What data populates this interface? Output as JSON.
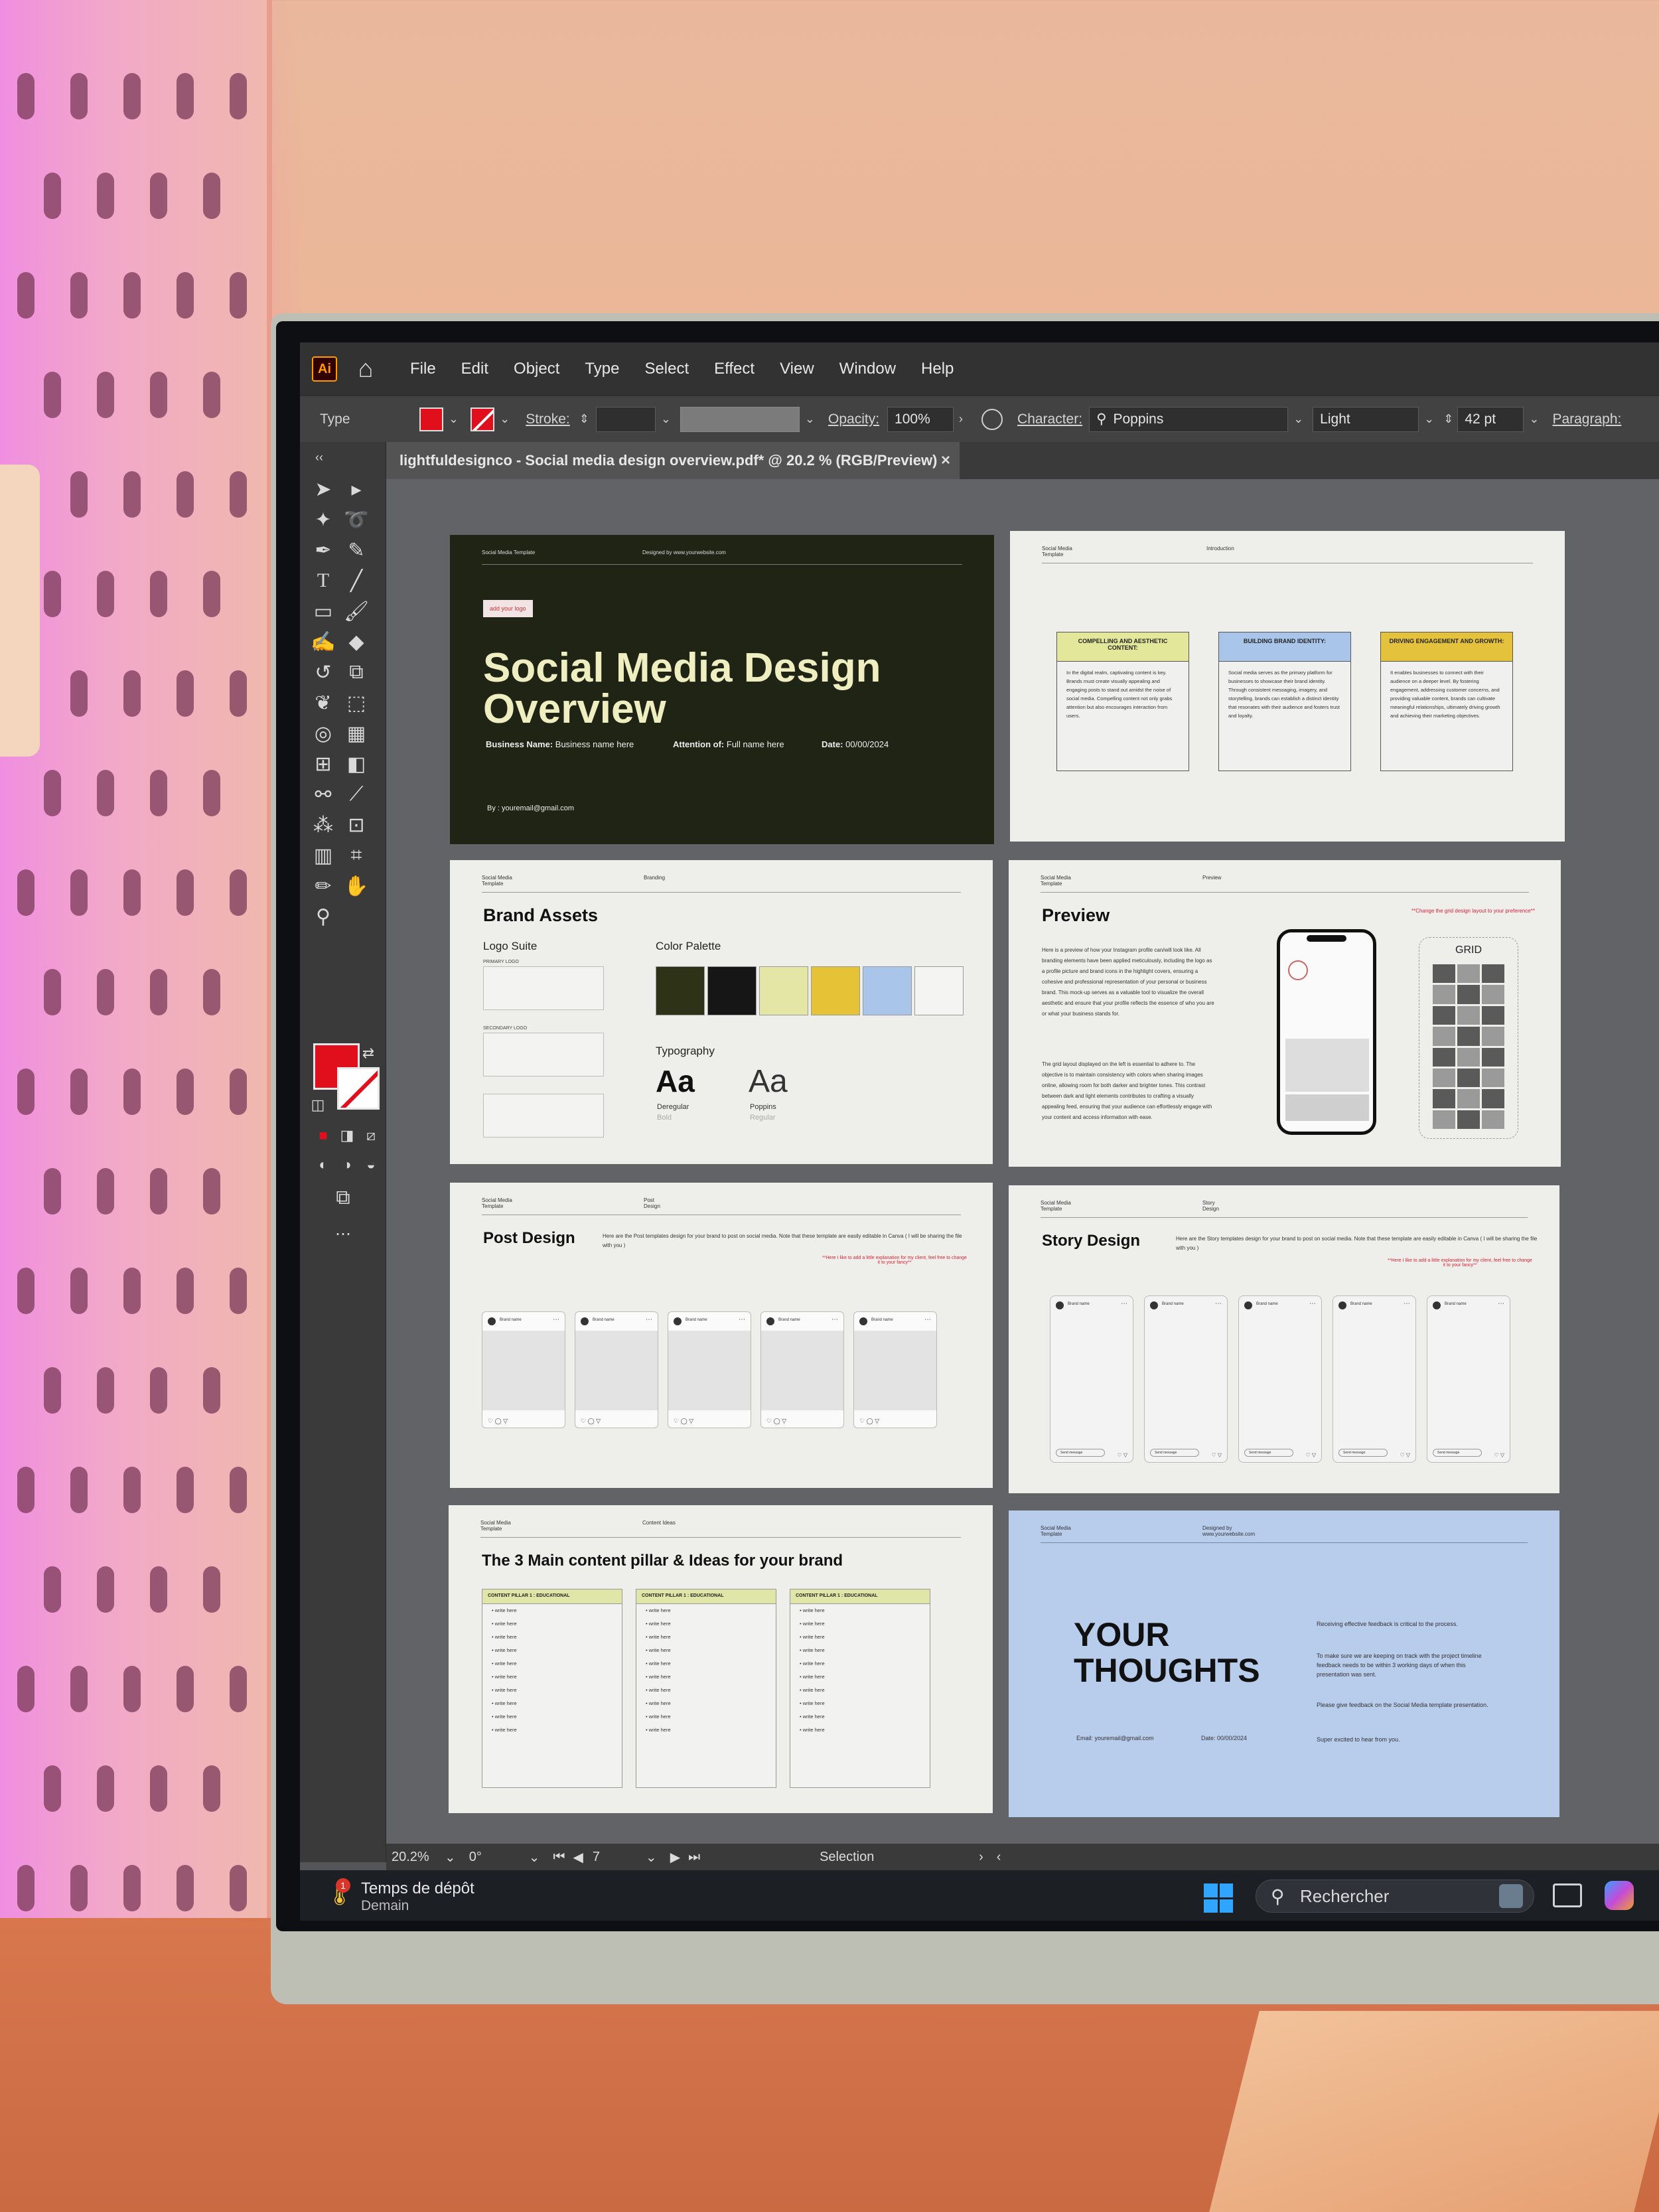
{
  "app": {
    "logo": "Ai",
    "menu": [
      "File",
      "Edit",
      "Object",
      "Type",
      "Select",
      "Effect",
      "View",
      "Window",
      "Help"
    ]
  },
  "control": {
    "mode": "Type",
    "stroke_label": "Stroke:",
    "opacity_label": "Opacity:",
    "opacity_value": "100%",
    "character_label": "Character:",
    "font_family": "Poppins",
    "font_style": "Light",
    "font_size": "42 pt",
    "paragraph_label": "Paragraph:"
  },
  "document": {
    "tab_title": "lightfuldesignco - Social media design overview.pdf* @ 20.2 % (RGB/Preview)",
    "close": "×"
  },
  "status": {
    "zoom": "20.2%",
    "rotation": "0°",
    "page": "7",
    "tool": "Selection"
  },
  "taskbar": {
    "notification_count": "1",
    "weather_title": "Temps de dépôt",
    "weather_sub": "Demain",
    "search_placeholder": "Rechercher"
  },
  "colors": {
    "fill": "#e10e1c",
    "cover_bg": "#1f2415",
    "cover_title": "#efeec0",
    "thoughts_bg": "#b8ccec"
  },
  "slides": {
    "cover": {
      "head_left": "Social Media Template",
      "head_right": "Designed by www.yourwebsite.com",
      "logo_label": "add your logo",
      "title": "Social Media Design Overview",
      "business_label": "Business Name:",
      "business_value": "Business name here",
      "attention_label": "Attention of:",
      "attention_value": "Full name here",
      "date_label": "Date:",
      "date_value": "00/00/2024",
      "by": "By : youremail@gmail.com"
    },
    "intro": {
      "head_left": "Social Media Template",
      "head_right": "Introduction",
      "cards": [
        {
          "title": "COMPELLING AND AESTHETIC CONTENT:",
          "body": "In the digital realm, captivating content is key. Brands must create visually appealing and engaging posts to stand out amidst the noise of social media. Compelling content not only grabs attention but also encourages interaction from users.",
          "color": "#e3e79a"
        },
        {
          "title": "BUILDING BRAND IDENTITY:",
          "body": "Social media serves as the primary platform for businesses to showcase their brand identity. Through consistent messaging, imagery, and storytelling, brands can establish a distinct identity that resonates with their audience and fosters trust and loyalty.",
          "color": "#a9c5ea"
        },
        {
          "title": "DRIVING ENGAGEMENT AND GROWTH:",
          "body": "It enables businesses to connect with their audience on a deeper level. By fostering engagement, addressing customer concerns, and providing valuable content, brands can cultivate meaningful relationships, ultimately driving growth and achieving their marketing objectives.",
          "color": "#e4c23c"
        }
      ]
    },
    "brand": {
      "head_left": "Social Media Template",
      "head_right": "Branding",
      "title": "Brand Assets",
      "logo_suite": "Logo Suite",
      "primary_logo": "PRIMARY LOGO",
      "secondary_logo": "SECONDARY LOGO",
      "palette_title": "Color Palette",
      "palette": [
        "#2e3318",
        "#161616",
        "#e4e6a6",
        "#e5c236",
        "#a9c5ea",
        "#f4f4f2"
      ],
      "typography": "Typography",
      "font1_sample": "Aa",
      "font1_name": "Deregular",
      "font1_style": "Bold",
      "font2_sample": "Aa",
      "font2_name": "Poppins",
      "font2_style": "Regular"
    },
    "preview": {
      "head_left": "Social Media Template",
      "head_right": "Preview",
      "title": "Preview",
      "para1": "Here is a preview of how your Instagram profile can/will look like. All branding elements have been applied meticulously, including the logo as a profile picture and brand icons in the highlight covers, ensuring a cohesive and professional representation of your personal or business brand. This mock-up serves as a valuable tool to visualize the overall aesthetic and ensure that your profile reflects the essence of who you are or what your business stands for.",
      "para2": "The grid layout displayed on the left is essential to adhere to. The objective is to maintain consistency with colors when sharing images online, allowing room for both darker and brighter tones. This contrast between dark and light elements contributes to crafting a visually appealing feed, ensuring that your audience can effortlessly engage with your content and access information with ease.",
      "note": "**Change the grid design layout to your preference**",
      "grid_label": "GRID",
      "grid": [
        1,
        0,
        1,
        0,
        1,
        0,
        1,
        0,
        1,
        0,
        1,
        0,
        1,
        0,
        1,
        0,
        1,
        0,
        1,
        0,
        1,
        0,
        1,
        0
      ]
    },
    "post": {
      "head_left": "Social Media Template",
      "head_right": "Post Design",
      "title": "Post Design",
      "desc": "Here are the Post templates design for your brand to post on social media. Note that these template are easily editable in Canva ( I will be sharing the file with you )",
      "note": "**Here I like to add a little explanation for my client, feel free to change it to your fancy**",
      "card_label": "Brand name"
    },
    "story": {
      "head_left": "Social Media Template",
      "head_right": "Story Design",
      "title": "Story Design",
      "desc": "Here are the Story templates design for your brand to post on social media. Note that these template are easily editable in Canva ( I will be sharing the file with you )",
      "note": "**Here I like to add a little explanation for my client, feel free to change it to your fancy**",
      "card_label": "Brand name",
      "send_label": "Send message"
    },
    "pillars": {
      "head_left": "Social Media Template",
      "head_right": "Content Ideas",
      "title": "The 3 Main content pillar & Ideas for your brand",
      "columns": [
        "CONTENT PILLAR 1 : EDUCATIONAL",
        "CONTENT PILLAR 1 : EDUCATIONAL",
        "CONTENT PILLAR 1 : EDUCATIONAL"
      ],
      "item": "write here"
    },
    "thoughts": {
      "head_left": "Social Media Template",
      "head_right": "Designed by www.yourwebsite.com",
      "title_line1": "YOUR",
      "title_line2": "THOUGHTS",
      "email": "Email: youremail@gmail.com",
      "date": "Date: 00/00/2024",
      "p1": "Receiving effective feedback is critical to the process.",
      "p2": "To make sure we are keeping on track with the project timeline feedback needs to be within 3 working days of when this presentation was sent.",
      "p3": "Please give feedback on the Social Media template presentation.",
      "p4": "Super excited to hear from you."
    }
  }
}
